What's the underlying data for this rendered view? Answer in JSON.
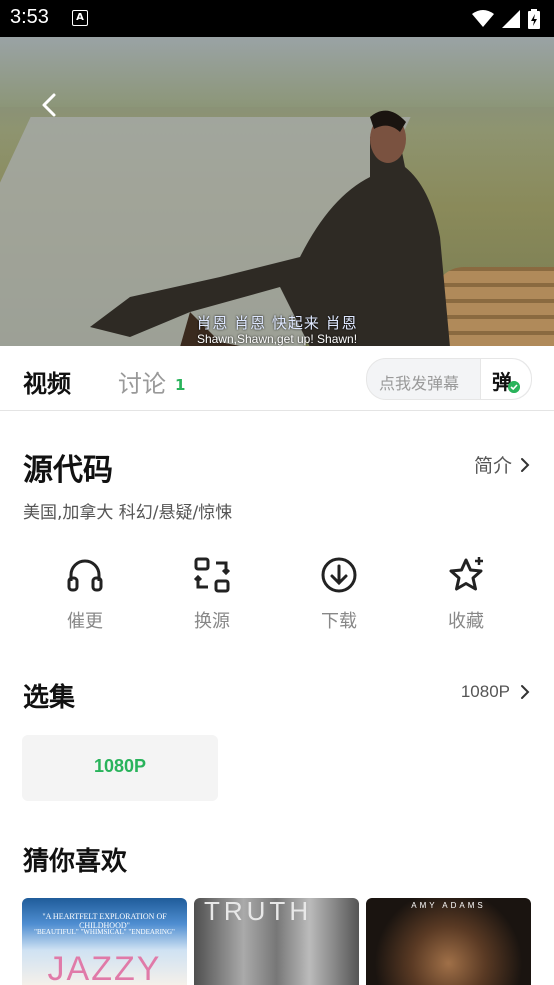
{
  "status_bar": {
    "time": "3:53",
    "indicator": "A"
  },
  "video": {
    "subtitle_cn": "肖恩  肖恩  快起来  肖恩",
    "subtitle_en": "Shawn,Shawn,get up! Shawn!"
  },
  "tabs": {
    "video_label": "视频",
    "discuss_label": "讨论",
    "discuss_count": "1",
    "danmaku_placeholder": "点我发弹幕",
    "danmaku_button": "弹"
  },
  "detail": {
    "title": "源代码",
    "intro_label": "简介",
    "meta": "美国,加拿大  科幻/悬疑/惊悚"
  },
  "actions": [
    {
      "label": "催更",
      "icon": "headphones-icon"
    },
    {
      "label": "换源",
      "icon": "switch-source-icon"
    },
    {
      "label": "下载",
      "icon": "download-icon"
    },
    {
      "label": "收藏",
      "icon": "star-icon"
    }
  ],
  "episodes": {
    "heading": "选集",
    "quality": "1080P",
    "items": [
      "1080P"
    ]
  },
  "recommend": {
    "heading": "猜你喜欢",
    "posters": [
      {
        "tagline": "\"A HEARTFELT EXPLORATION OF CHILDHOOD\"",
        "subtag": "\"BEAUTIFUL\"   \"WHIMSICAL\"   \"ENDEARING\"",
        "title": "JAZZY"
      },
      {
        "title": "TRUTH"
      },
      {
        "title": "AMY ADAMS"
      }
    ]
  }
}
